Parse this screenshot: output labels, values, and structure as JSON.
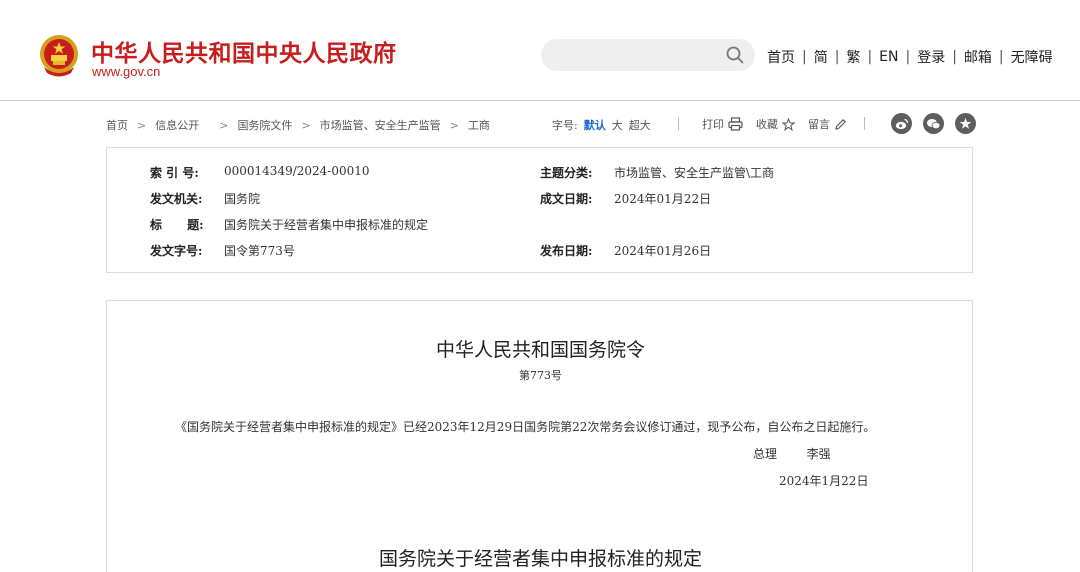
{
  "header": {
    "site_name": "中华人民共和国中央人民政府",
    "site_url": "www.gov.cn",
    "nav": [
      "首页",
      "简",
      "繁",
      "EN",
      "登录",
      "邮箱",
      "无障碍"
    ],
    "separator": "|",
    "brand_color": "#c81d1d"
  },
  "breadcrumb": {
    "items": [
      "首页",
      "信息公开",
      "国务院文件",
      "市场监管、安全生产监管",
      "工商"
    ],
    "separator": ">"
  },
  "fontsize": {
    "label": "字号:",
    "options": [
      "默认",
      "大",
      "超大"
    ],
    "active": "默认"
  },
  "tools": {
    "print": "打印",
    "favorite": "收藏",
    "comment": "留言"
  },
  "share": [
    "weibo-icon",
    "wechat-icon",
    "star-icon"
  ],
  "info": {
    "index_label": "索 引 号:",
    "index_value": "000014349/2024-00010",
    "topic_label": "主题分类:",
    "topic_value": "市场监管、安全生产监管\\工商",
    "issuer_label": "发文机关:",
    "issuer_value": "国务院",
    "created_label": "成文日期:",
    "created_value": "2024年01月22日",
    "title_label": "标      题:",
    "title_value": "国务院关于经营者集中申报标准的规定",
    "docno_label": "发文字号:",
    "docno_value": "国令第773号",
    "published_label": "发布日期:",
    "published_value": "2024年01月26日"
  },
  "document": {
    "title": "中华人民共和国国务院令",
    "number": "第773号",
    "paragraph": "《国务院关于经营者集中申报标准的规定》已经2023年12月29日国务院第22次常务会议修订通过，现予公布，自公布之日起施行。",
    "signer_title": "总理",
    "signer_name": "李强",
    "date": "2024年1月22日",
    "subtitle": "国务院关于经营者集中申报标准的规定"
  },
  "colors": {
    "accent": "#1a6bd2",
    "border": "#dcdcdc"
  }
}
